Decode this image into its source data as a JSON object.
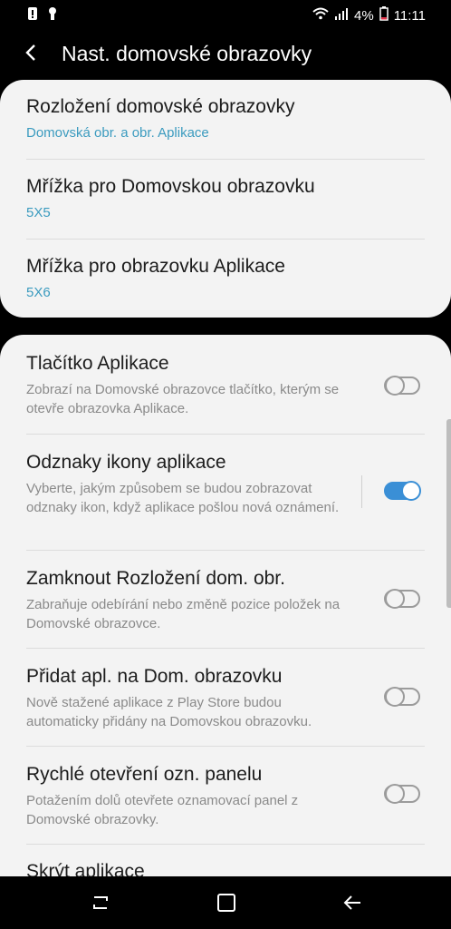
{
  "status": {
    "battery": "4%",
    "time": "11:11"
  },
  "header": {
    "title": "Nast. domovské obrazovky"
  },
  "layout_group": [
    {
      "title": "Rozložení domovské obrazovky",
      "value": "Domovská obr. a obr. Aplikace"
    },
    {
      "title": "Mřížka pro Domovskou obrazovku",
      "value": "5X5"
    },
    {
      "title": "Mřížka pro obrazovku Aplikace",
      "value": "5X6"
    }
  ],
  "toggles": [
    {
      "title": "Tlačítko Aplikace",
      "desc": "Zobrazí na Domovské obrazovce tlačítko, kterým se otevře obrazovka Aplikace.",
      "on": false
    },
    {
      "title": "Odznaky ikony aplikace",
      "desc": "Vyberte, jakým způsobem se budou zobrazovat odznaky ikon, když aplikace pošlou nová oznámení.",
      "on": true
    },
    {
      "title": "Zamknout Rozložení dom. obr.",
      "desc": "Zabraňuje odebírání nebo změně pozice položek na Domovské obrazovce.",
      "on": false
    },
    {
      "title": "Přidat apl. na Dom. obrazovku",
      "desc": "Nově stažené aplikace z Play Store budou automaticky přidány na Domovskou obrazovku.",
      "on": false
    },
    {
      "title": "Rychlé otevření ozn. panelu",
      "desc": "Potažením dolů otevřete oznamovací panel z Domovské obrazovky.",
      "on": false
    }
  ],
  "partial_item": {
    "title": "Skrýt aplikace"
  },
  "colors": {
    "accent": "#3a8fd6",
    "value_text": "#3b9bbf",
    "card_bg": "#f3f3f3"
  },
  "icons": {
    "status_left": [
      "alert-icon",
      "lock-icon"
    ],
    "status_right": [
      "wifi-icon",
      "signal-icon",
      "battery-icon"
    ],
    "nav": [
      "recents-icon",
      "home-icon",
      "back-icon"
    ]
  }
}
